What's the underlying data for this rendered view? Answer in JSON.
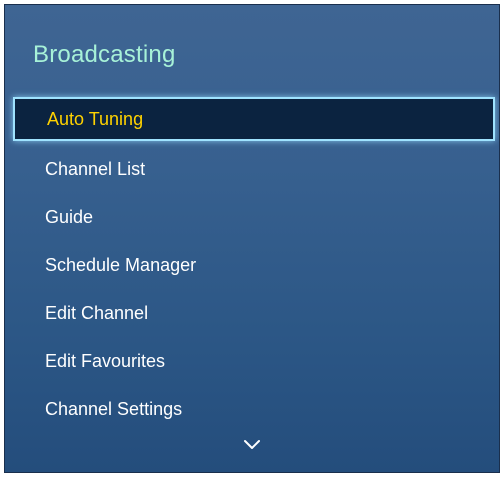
{
  "menu": {
    "title": "Broadcasting",
    "items": [
      {
        "label": "Auto Tuning",
        "selected": true
      },
      {
        "label": "Channel List",
        "selected": false
      },
      {
        "label": "Guide",
        "selected": false
      },
      {
        "label": "Schedule Manager",
        "selected": false
      },
      {
        "label": "Edit Channel",
        "selected": false
      },
      {
        "label": "Edit Favourites",
        "selected": false
      },
      {
        "label": "Channel Settings",
        "selected": false
      }
    ],
    "scroll_icon": "chevron-down-icon"
  },
  "colors": {
    "panel": "#37608f",
    "title": "#a7f2d8",
    "item_text": "#ffffff",
    "selected_text": "#ffd200",
    "selected_bg": "#0b2340",
    "selected_border": "#9fe3ff"
  }
}
